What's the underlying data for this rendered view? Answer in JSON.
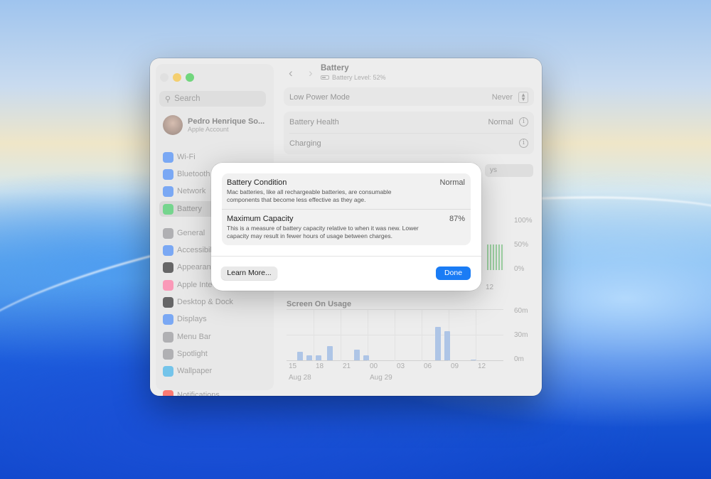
{
  "window": {
    "title": "Battery",
    "subtitle": "Battery Level: 52%"
  },
  "sidebar": {
    "search_placeholder": "Search",
    "account": {
      "name": "Pedro Henrique So...",
      "subtitle": "Apple Account"
    },
    "items": [
      {
        "label": "Wi-Fi",
        "icon": "wifi-icon",
        "color": "#3b82f6"
      },
      {
        "label": "Bluetooth",
        "icon": "bluetooth-icon",
        "color": "#3b82f6"
      },
      {
        "label": "Network",
        "icon": "globe-icon",
        "color": "#3b82f6"
      },
      {
        "label": "Battery",
        "icon": "battery-icon",
        "color": "#34c759",
        "selected": true
      },
      {
        "label": "General",
        "icon": "gear-icon",
        "color": "#8e8e93"
      },
      {
        "label": "Accessibili",
        "icon": "accessibility-icon",
        "color": "#3b82f6"
      },
      {
        "label": "Appearanc",
        "icon": "appearance-icon",
        "color": "#1c1c1e"
      },
      {
        "label": "Apple Inte",
        "icon": "apple-intelligence-icon",
        "color": "#ff6b9a"
      },
      {
        "label": "Desktop & Dock",
        "icon": "dock-icon",
        "color": "#1c1c1e"
      },
      {
        "label": "Displays",
        "icon": "sun-icon",
        "color": "#3b82f6"
      },
      {
        "label": "Menu Bar",
        "icon": "menubar-icon",
        "color": "#8e8e93"
      },
      {
        "label": "Spotlight",
        "icon": "search-icon",
        "color": "#8e8e93"
      },
      {
        "label": "Wallpaper",
        "icon": "wallpaper-icon",
        "color": "#32ade6"
      },
      {
        "label": "Notifications",
        "icon": "bell-icon",
        "color": "#ff3b30"
      }
    ]
  },
  "settings": {
    "low_power_label": "Low Power Mode",
    "low_power_value": "Never",
    "health_label": "Battery Health",
    "health_value": "Normal",
    "charging_label": "Charging",
    "segment_partial": "ys"
  },
  "level_chart": {
    "y_labels": [
      "100%",
      "50%",
      "0%"
    ],
    "x_partial": "12"
  },
  "screen_usage": {
    "title": "Screen On Usage",
    "y_labels": [
      "60m",
      "30m",
      "0m"
    ],
    "x_labels": [
      "15",
      "18",
      "21",
      "00",
      "03",
      "06",
      "09",
      "12"
    ],
    "date_labels": [
      "Aug 28",
      "Aug 29"
    ]
  },
  "chart_data": {
    "type": "bar",
    "title": "Screen On Usage",
    "ylim": [
      0,
      60
    ],
    "y_unit": "m",
    "x_ticks": [
      "15",
      "18",
      "21",
      "00",
      "03",
      "06",
      "09",
      "12"
    ],
    "slots": [
      {
        "hour": "15",
        "value": 10
      },
      {
        "hour": "16",
        "value": 6
      },
      {
        "hour": "17",
        "value": 6
      },
      {
        "hour": "18",
        "value": 17
      },
      {
        "hour": "20",
        "value": 13
      },
      {
        "hour": "21",
        "value": 6
      },
      {
        "hour": "06",
        "value": 40
      },
      {
        "hour": "07",
        "value": 35
      },
      {
        "hour": "11",
        "value": 1
      }
    ]
  },
  "modal": {
    "condition_title": "Battery Condition",
    "condition_value": "Normal",
    "condition_desc": "Mac batteries, like all rechargeable batteries, are consumable components that become less effective as they age.",
    "capacity_title": "Maximum Capacity",
    "capacity_value": "87%",
    "capacity_desc": "This is a measure of battery capacity relative to when it was new. Lower capacity may result in fewer hours of usage between charges.",
    "learn_more": "Learn More...",
    "done": "Done"
  }
}
